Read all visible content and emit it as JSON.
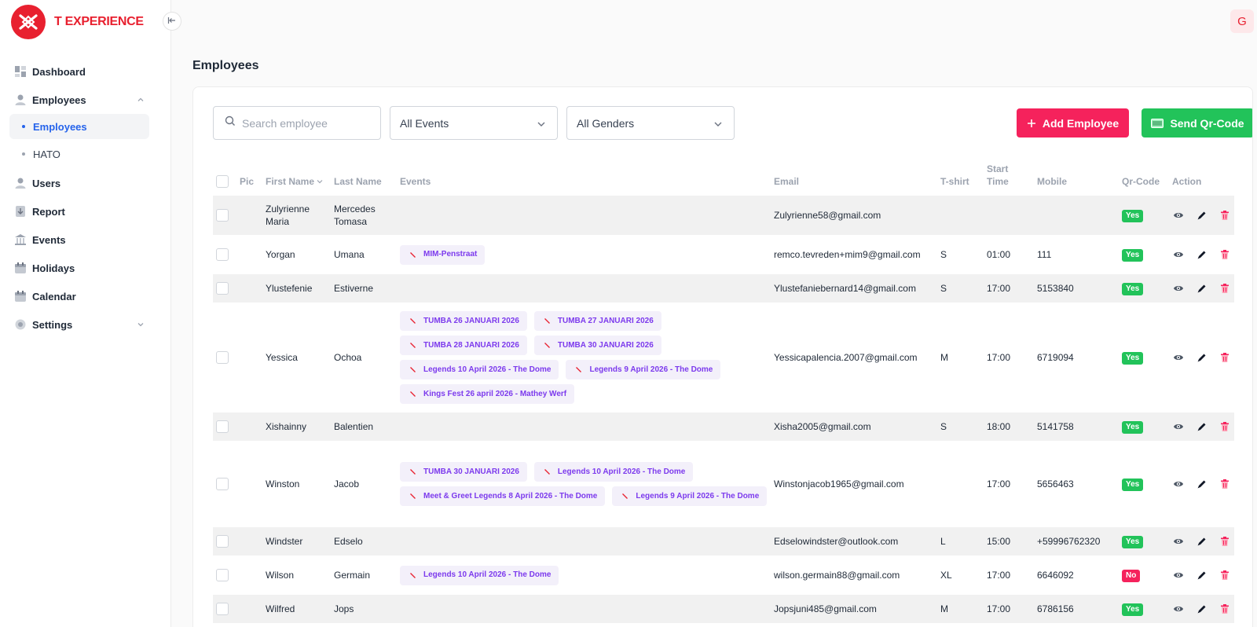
{
  "brand": {
    "name": "T EXPERIENCE",
    "accent": "#e8202f"
  },
  "user": {
    "avatar_initial": "G"
  },
  "sidebar": {
    "items": [
      {
        "label": "Dashboard",
        "icon": "dashboard-icon"
      },
      {
        "label": "Employees",
        "icon": "person-icon",
        "expanded": true,
        "children": [
          {
            "label": "Employees",
            "active": true
          },
          {
            "label": "HATO",
            "active": false
          }
        ]
      },
      {
        "label": "Users",
        "icon": "person-icon"
      },
      {
        "label": "Report",
        "icon": "report-icon"
      },
      {
        "label": "Events",
        "icon": "bank-icon"
      },
      {
        "label": "Holidays",
        "icon": "calendar-icon"
      },
      {
        "label": "Calendar",
        "icon": "calendar-icon"
      },
      {
        "label": "Settings",
        "icon": "gear-icon",
        "expanded": false
      }
    ]
  },
  "page": {
    "title": "Employees"
  },
  "toolbar": {
    "search_placeholder": "Search employee",
    "events_filter": "All Events",
    "genders_filter": "All Genders",
    "add_label": "Add Employee",
    "qr_label": "Send Qr-Code",
    "add_color": "#f5225c",
    "qr_color": "#22c35a"
  },
  "table": {
    "headers": {
      "pic": "Pic",
      "first_name": "First Name",
      "last_name": "Last Name",
      "events": "Events",
      "email": "Email",
      "tshirt": "T-shirt",
      "start_time": "Start Time",
      "mobile": "Mobile",
      "qr": "Qr-Code",
      "action": "Action"
    },
    "rows": [
      {
        "first": "Zulyrienne Maria",
        "last": "Mercedes Tomasa",
        "events": [],
        "email": "Zulyrienne58@gmail.com",
        "tshirt": "",
        "start": "",
        "mobile": "",
        "qr": "Yes"
      },
      {
        "first": "Yorgan",
        "last": "Umana",
        "events": [
          "MIM-Penstraat"
        ],
        "email": "remco.tevreden+mim9@gmail.com",
        "tshirt": "S",
        "start": "01:00",
        "mobile": "111",
        "qr": "Yes"
      },
      {
        "first": "Ylustefenie",
        "last": "Estiverne",
        "events": [],
        "email": "Ylustefaniebernard14@gmail.com",
        "tshirt": "S",
        "start": "17:00",
        "mobile": "5153840",
        "qr": "Yes"
      },
      {
        "first": "Yessica",
        "last": "Ochoa",
        "events": [
          "TUMBA 26 JANUARI 2026",
          "TUMBA 27 JANUARI 2026",
          "TUMBA 28 JANUARI 2026",
          "TUMBA 30 JANUARI 2026",
          "Legends 10 April 2026 - The Dome",
          "Legends 9 April 2026 - The Dome",
          "Kings Fest 26 april 2026 - Mathey Werf"
        ],
        "email": "Yessicapalencia.2007@gmail.com",
        "tshirt": "M",
        "start": "17:00",
        "mobile": "6719094",
        "qr": "Yes"
      },
      {
        "first": "Xishainny",
        "last": "Balentien",
        "events": [],
        "email": "Xisha2005@gmail.com",
        "tshirt": "S",
        "start": "18:00",
        "mobile": "5141758",
        "qr": "Yes"
      },
      {
        "first": "Winston",
        "last": "Jacob",
        "events": [
          "TUMBA 30 JANUARI 2026",
          "Legends 10 April 2026 - The Dome",
          "Meet & Greet Legends 8 April 2026 - The Dome",
          "Legends 9 April 2026 - The Dome"
        ],
        "email": "Winstonjacob1965@gmail.com",
        "tshirt": "",
        "start": "17:00",
        "mobile": "5656463",
        "qr": "Yes"
      },
      {
        "first": "Windster",
        "last": "Edselo",
        "events": [],
        "email": "Edselowindster@outlook.com",
        "tshirt": "L",
        "start": "15:00",
        "mobile": "+59996762320",
        "qr": "Yes"
      },
      {
        "first": "Wilson",
        "last": "Germain",
        "events": [
          "Legends 10 April 2026 - The Dome"
        ],
        "email": "wilson.germain88@gmail.com",
        "tshirt": "XL",
        "start": "17:00",
        "mobile": "6646092",
        "qr": "No"
      },
      {
        "first": "Wilfred",
        "last": "Jops",
        "events": [],
        "email": "Jopsjuni485@gmail.com",
        "tshirt": "M",
        "start": "17:00",
        "mobile": "6786156",
        "qr": "Yes"
      }
    ]
  }
}
